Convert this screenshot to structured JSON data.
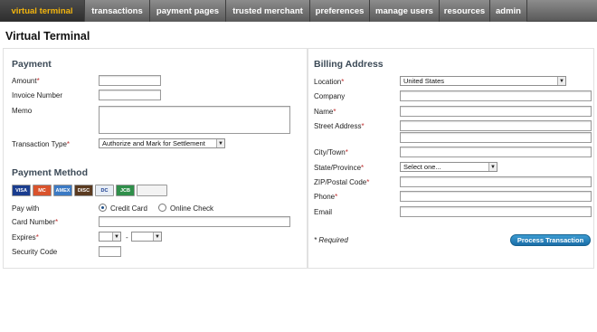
{
  "nav": {
    "tabs": [
      {
        "label": "virtual terminal"
      },
      {
        "label": "transactions"
      },
      {
        "label": "payment pages"
      },
      {
        "label": "trusted merchant"
      },
      {
        "label": "preferences"
      },
      {
        "label": "manage users"
      },
      {
        "label": "resources"
      },
      {
        "label": "admin"
      }
    ]
  },
  "page": {
    "title": "Virtual Terminal"
  },
  "payment": {
    "title": "Payment",
    "amount_label": "Amount",
    "invoice_label": "Invoice Number",
    "memo_label": "Memo",
    "transaction_type_label": "Transaction Type",
    "transaction_type_value": "Authorize and Mark for Settlement"
  },
  "payment_method": {
    "title": "Payment Method",
    "pay_with_label": "Pay with",
    "credit_card_label": "Credit Card",
    "online_check_label": "Online Check",
    "card_number_label": "Card Number",
    "expires_label": "Expires",
    "expires_separator": "-",
    "security_code_label": "Security Code",
    "cards": [
      {
        "icon": "visa-card-icon",
        "text": "VISA",
        "color": "#1a3d8f"
      },
      {
        "icon": "mastercard-card-icon",
        "text": "MC",
        "color": "#d9532c"
      },
      {
        "icon": "amex-card-icon",
        "text": "AMEX",
        "color": "#3b7ac4"
      },
      {
        "icon": "discover-card-icon",
        "text": "DISC",
        "color": "#5a3a20"
      },
      {
        "icon": "diners-card-icon",
        "text": "DC",
        "color": "#e8eef6"
      },
      {
        "icon": "jcb-card-icon",
        "text": "JCB",
        "color": "#2f8f4a"
      },
      {
        "icon": "echeck-icon",
        "text": "",
        "color": "#f3f3f3"
      }
    ]
  },
  "billing": {
    "title": "Billing Address",
    "location_label": "Location",
    "location_value": "United States",
    "company_label": "Company",
    "name_label": "Name",
    "street_label": "Street Address",
    "city_label": "City/Town",
    "state_label": "State/Province",
    "state_value": "Select one...",
    "zip_label": "ZIP/Postal Code",
    "phone_label": "Phone",
    "email_label": "Email"
  },
  "footer": {
    "required_note": "* Required",
    "process_button": "Process Transaction"
  },
  "required_marker": "*"
}
